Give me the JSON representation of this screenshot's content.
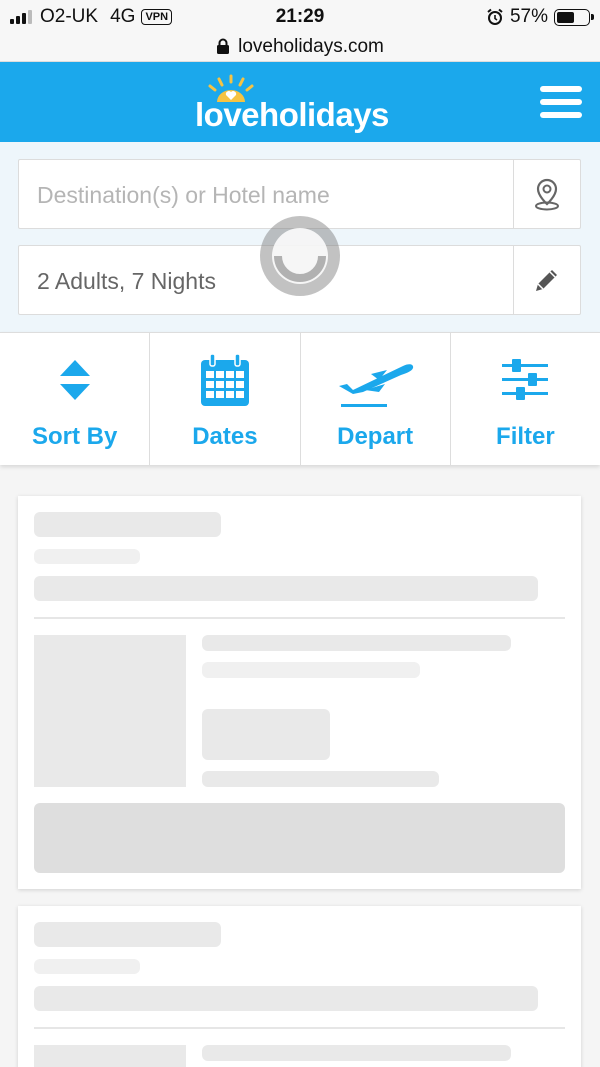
{
  "status_bar": {
    "carrier": "O2-UK",
    "network": "4G",
    "vpn": "VPN",
    "time": "21:29",
    "battery": "57%",
    "battery_level": 0.57
  },
  "url_bar": {
    "domain": "loveholidays.com"
  },
  "header": {
    "brand": "loveholidays"
  },
  "search": {
    "destination_placeholder": "Destination(s) or Hotel name",
    "party_value": "2 Adults, 7 Nights"
  },
  "toolbar": {
    "items": [
      {
        "label": "Sort By",
        "icon": "sort-arrows-icon"
      },
      {
        "label": "Dates",
        "icon": "calendar-icon"
      },
      {
        "label": "Depart",
        "icon": "plane-icon"
      },
      {
        "label": "Filter",
        "icon": "sliders-icon"
      }
    ]
  },
  "colors": {
    "brand_blue": "#1ba8ec",
    "sun_yellow": "#f6c343",
    "skeleton": "#e9e9e9"
  }
}
